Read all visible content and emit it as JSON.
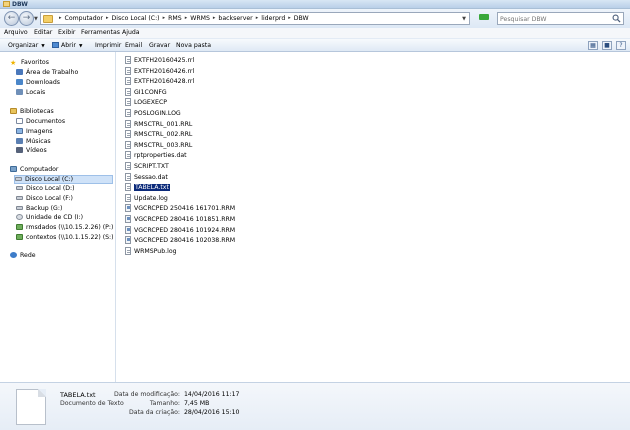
{
  "window": {
    "title": "DBW"
  },
  "address": {
    "crumbs": [
      "Computador",
      "Disco Local (C:)",
      "RMS",
      "WRMS",
      "backserver",
      "liderprd",
      "DBW"
    ]
  },
  "search": {
    "placeholder": "Pesquisar DBW"
  },
  "menu": [
    "Arquivo",
    "Editar",
    "Exibir",
    "Ferramentas",
    "Ajuda"
  ],
  "toolbar": {
    "organize": "Organizar",
    "open": "Abrir",
    "print": "Imprimir",
    "email": "Email",
    "burn": "Gravar",
    "new_folder": "Nova pasta"
  },
  "nav": {
    "favorites": {
      "label": "Favoritos",
      "items": [
        "Área de Trabalho",
        "Downloads",
        "Locais"
      ]
    },
    "libraries": {
      "label": "Bibliotecas",
      "items": [
        "Documentos",
        "Imagens",
        "Músicas",
        "Vídeos"
      ]
    },
    "computer": {
      "label": "Computador",
      "items": [
        "Disco Local (C:)",
        "Disco Local (D:)",
        "Disco Local (F:)",
        "Backup (G:)",
        "Unidade de CD (I:)",
        "rmsdados (\\\\10.15.2.26) (P:)",
        "contextos (\\\\10.1.15.22) (S:)"
      ]
    },
    "network": {
      "label": "Rede"
    }
  },
  "files": [
    "EXTFH20160425.rrl",
    "EXTFH20160426.rrl",
    "EXTFH20160428.rrl",
    "GI1CONFG",
    "LOGEXECP",
    "POSLOGIN.LOG",
    "RMSCTRL_001.RRL",
    "RMSCTRL_002.RRL",
    "RMSCTRL_003.RRL",
    "rptproperties.dat",
    "SCRIPT.TXT",
    "Sessao.dat",
    "TABELA.txt",
    "Update.log",
    "VGCRCPED 250416 161701.RRM",
    "VGCRCPED 280416 101851.RRM",
    "VGCRCPED 280416 101924.RRM",
    "VGCRCPED 280416 102038.RRM",
    "WRMSPub.log"
  ],
  "selected_file": "TABELA.txt",
  "details": {
    "name": "TABELA.txt",
    "type": "Documento de Texto",
    "modified_label": "Data de modificação:",
    "modified_value": "14/04/2016 11:17",
    "size_label": "Tamanho:",
    "size_value": "7,45 MB",
    "created_label": "Data da criação:",
    "created_value": "28/04/2016 15:10"
  }
}
